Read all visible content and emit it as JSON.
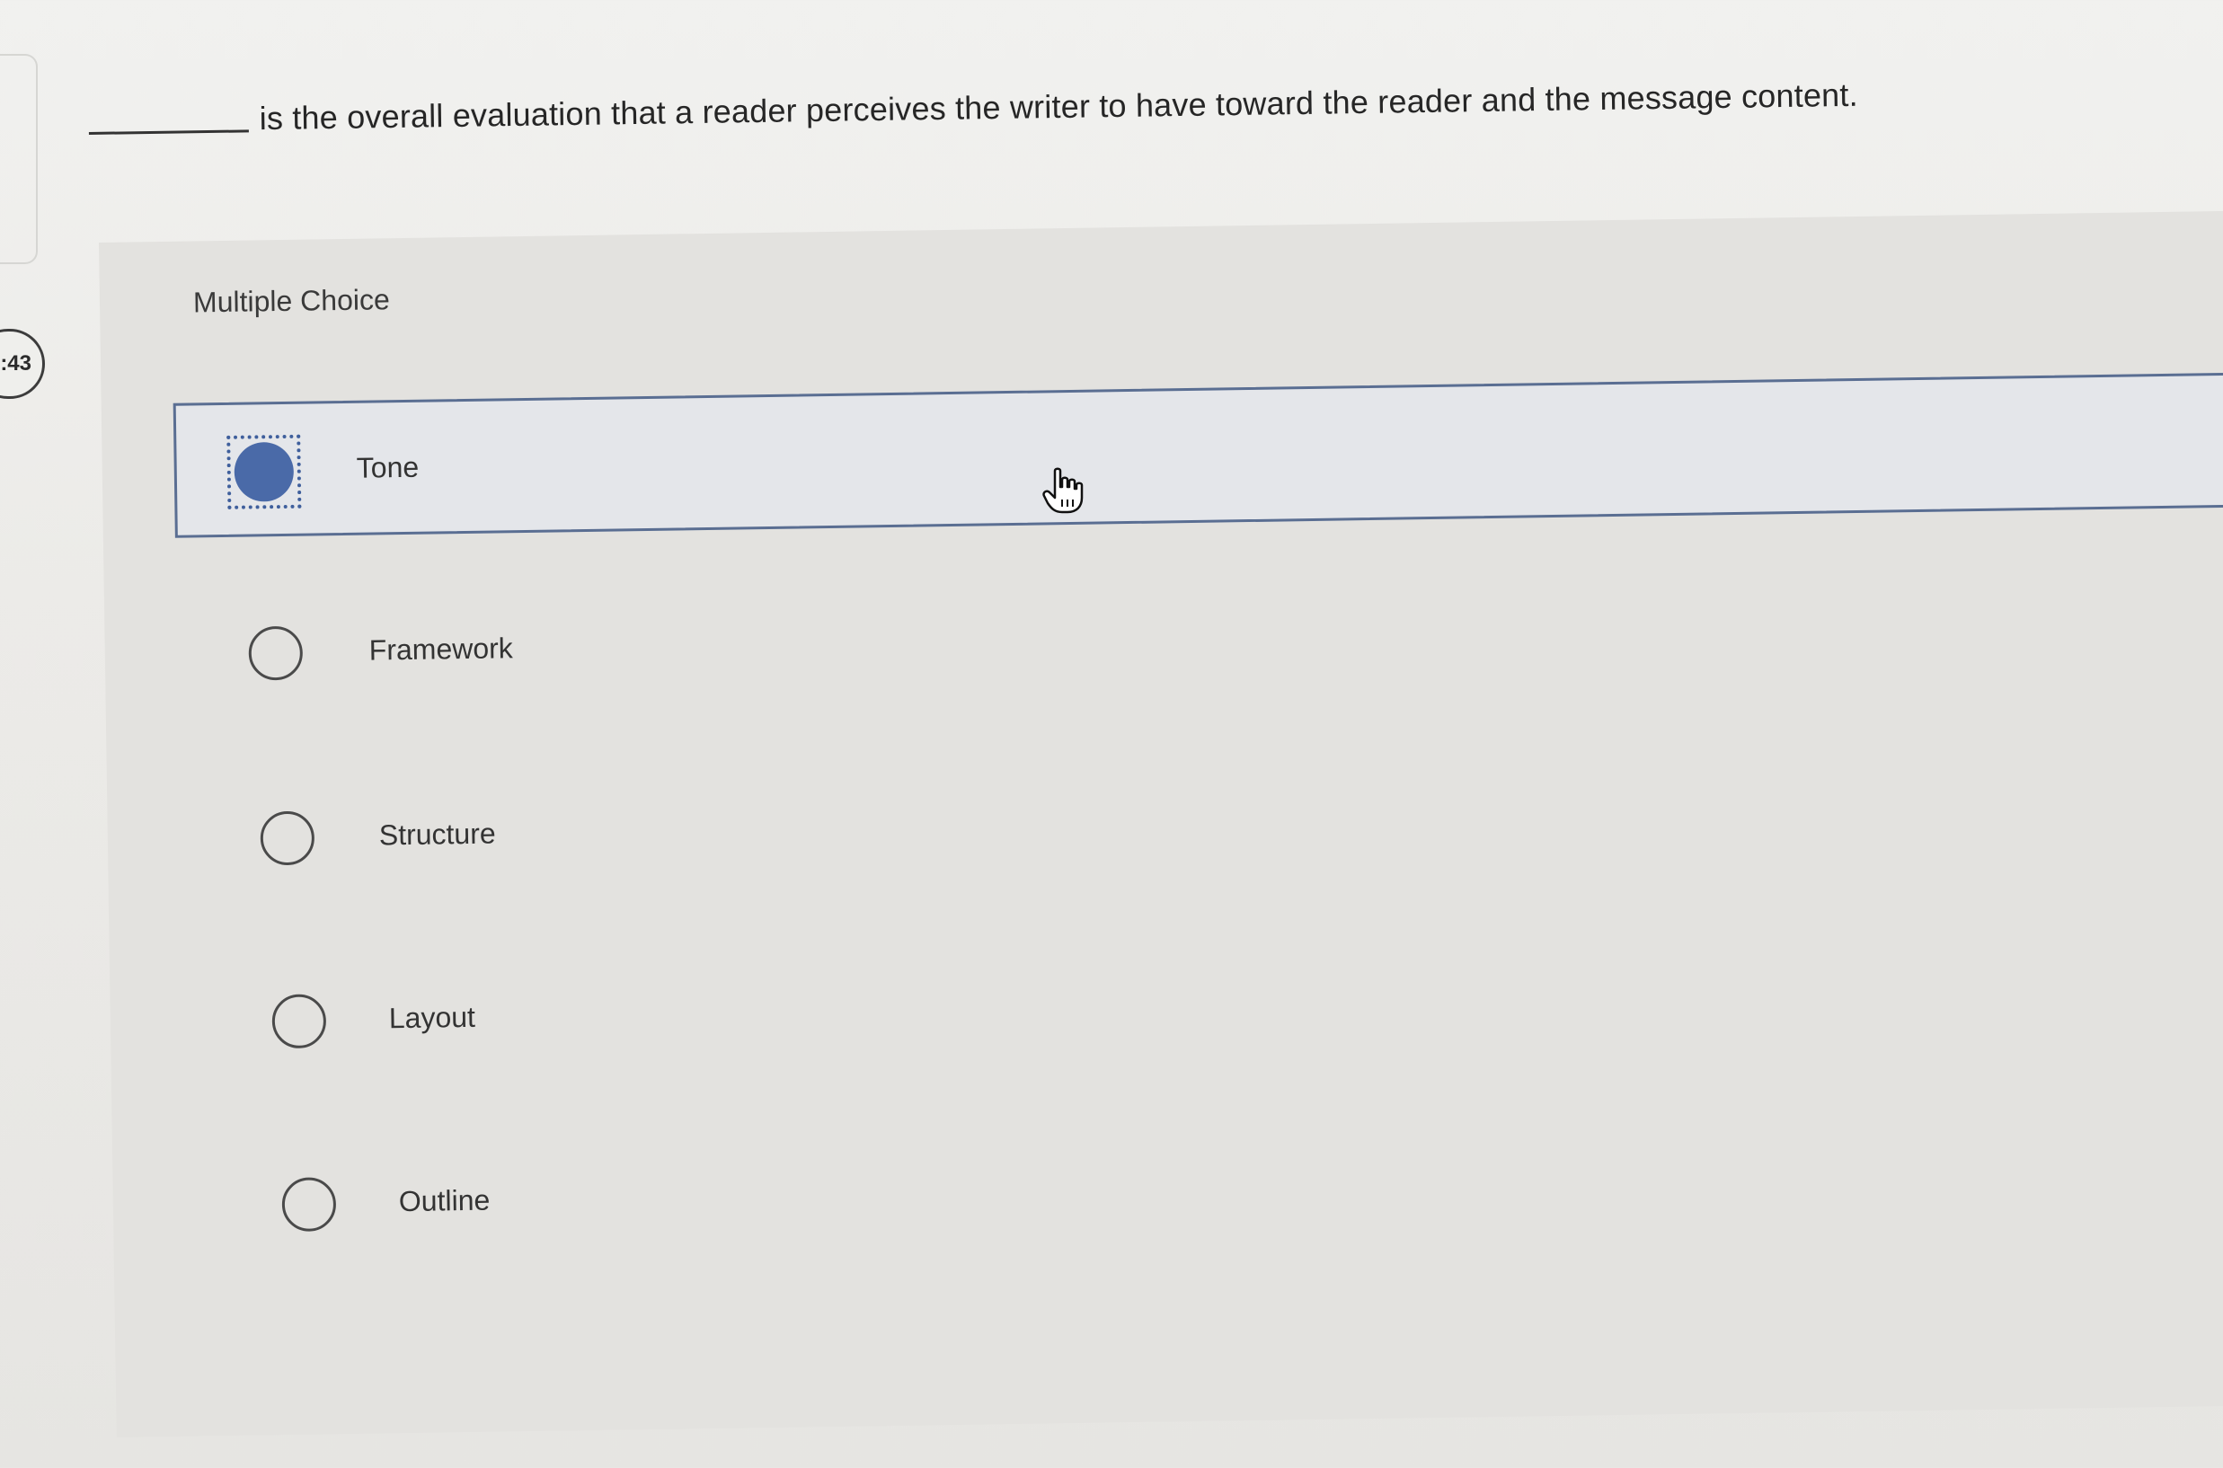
{
  "timer": {
    "text": ":43"
  },
  "question": {
    "text": "is the overall evaluation that a reader perceives the writer to have toward the reader and the message content."
  },
  "multiple_choice": {
    "label": "Multiple Choice",
    "options": [
      {
        "label": "Tone",
        "selected": true
      },
      {
        "label": "Framework",
        "selected": false
      },
      {
        "label": "Structure",
        "selected": false
      },
      {
        "label": "Layout",
        "selected": false
      },
      {
        "label": "Outline",
        "selected": false
      }
    ]
  },
  "icons": {
    "cursor": "hand-pointer-icon"
  },
  "colors": {
    "selected_fill": "#4a6aa8",
    "selected_border": "#5a6e92"
  }
}
